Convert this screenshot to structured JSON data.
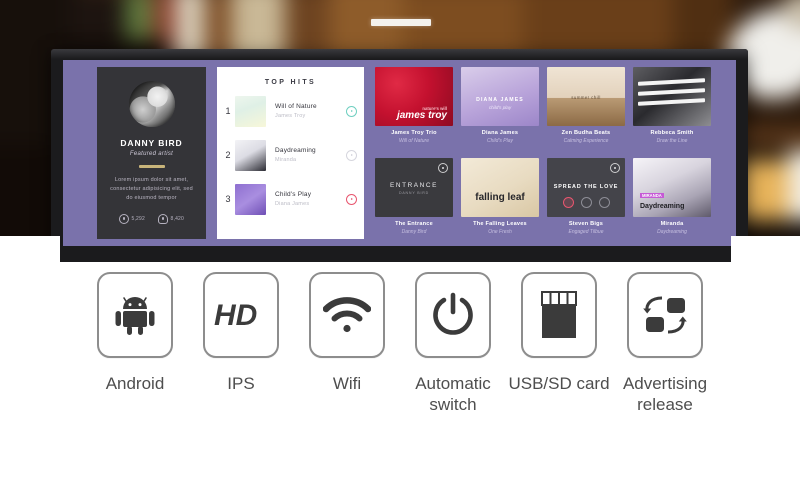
{
  "background": {
    "description": "blurred warm interior with wooden shelving",
    "top_bar_label": ""
  },
  "monitor": {
    "bezel_color": "#1b1b1d",
    "screen_bg_color": "#7a72ab"
  },
  "screen": {
    "artist_card": {
      "name": "DANNY BIRD",
      "role": "Featured artist",
      "description": "Lorem ipsum dolor sit amet, consectetur adipisicing elit, sed do eiusmod tempor",
      "stats": [
        {
          "icon": "play-count-icon",
          "value": "5,292"
        },
        {
          "icon": "followers-icon",
          "value": "8,420"
        }
      ]
    },
    "playlist": {
      "title": "TOP HITS",
      "tracks": [
        {
          "num": "1",
          "name": "Will of Nature",
          "artist": "James Troy",
          "accent": "green"
        },
        {
          "num": "2",
          "name": "Daydreaming",
          "artist": "Miranda",
          "accent": "grey"
        },
        {
          "num": "3",
          "name": "Child's Play",
          "artist": "Diana James",
          "accent": "red"
        }
      ]
    },
    "albums": [
      {
        "title": "James Troy Trio",
        "sub": "Will of Nature",
        "cover_top": "nature's will",
        "cover_main": "james troy",
        "style": "c-red",
        "badge": false
      },
      {
        "title": "Diana James",
        "sub": "Child's Play",
        "cover_top": "DIANA JAMES",
        "cover_main": "child's play",
        "style": "c-purple",
        "badge": false
      },
      {
        "title": "Zen Budha Beats",
        "sub": "Calming Experience",
        "cover_top": "summer chill",
        "cover_main": "",
        "style": "c-beach",
        "badge": false
      },
      {
        "title": "Rebbeca Smith",
        "sub": "Draw the Line",
        "cover_top": "",
        "cover_main": "",
        "style": "c-bw",
        "badge": false
      },
      {
        "title": "The Entrance",
        "sub": "Danny Bird",
        "cover_top": "ENTRANCE",
        "cover_main": "DANNY BIRD",
        "style": "c-dark",
        "badge": true
      },
      {
        "title": "The Falling Leaves",
        "sub": "One Fresh",
        "cover_top": "",
        "cover_main": "falling leaf",
        "style": "c-leaf",
        "badge": false
      },
      {
        "title": "Steven Bigs",
        "sub": "Engaged Tilbue",
        "cover_top": "SPREAD THE LOVE",
        "cover_main": "",
        "style": "c-love",
        "badge": true
      },
      {
        "title": "Miranda",
        "sub": "Daydreaming",
        "cover_top": "MIRANDA",
        "cover_main": "Daydreaming",
        "style": "c-mir",
        "badge": false
      }
    ]
  },
  "features": [
    {
      "icon": "android-icon",
      "label": "Android"
    },
    {
      "icon": "hd-icon",
      "label": "IPS"
    },
    {
      "icon": "wifi-icon",
      "label": "Wifi"
    },
    {
      "icon": "power-icon",
      "label": "Automatic switch"
    },
    {
      "icon": "sd-card-icon",
      "label": "USB/SD card"
    },
    {
      "icon": "sync-swap-icon",
      "label": "Advertising release"
    }
  ]
}
